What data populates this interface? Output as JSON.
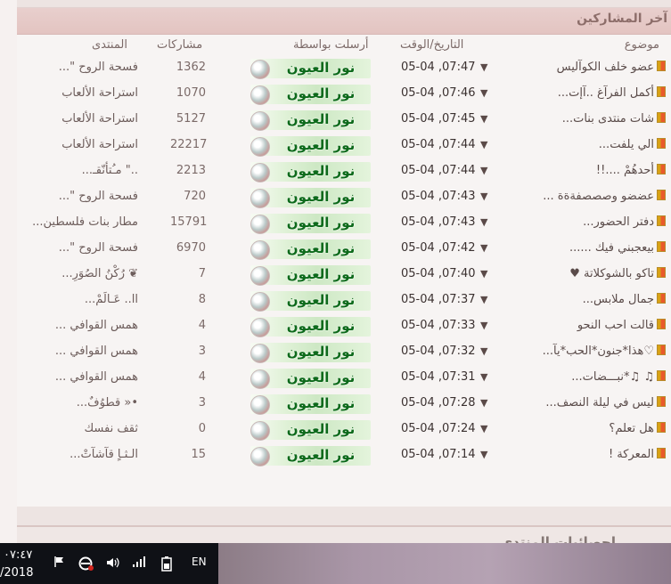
{
  "panel": {
    "title": "آخر المشاركين",
    "headers": {
      "topic": "موضوع",
      "date": "التاريخ/الوقت",
      "sender": "أرسلت بواسطة",
      "posts": "مشاركات",
      "forum": "المنتدى"
    },
    "rows": [
      {
        "topic": "عضو خلف الكوآليس",
        "date": "05-04 ,07:47",
        "sender": "نور العيون",
        "posts": "1362",
        "forum": "فسحة الروح \"..."
      },
      {
        "topic": "أكمل الفرآغ ..آإت...",
        "date": "05-04 ,07:46",
        "sender": "نور العيون",
        "posts": "1070",
        "forum": "استراحة الألعاب"
      },
      {
        "topic": "شات منتدى بنات...",
        "date": "05-04 ,07:45",
        "sender": "نور العيون",
        "posts": "5127",
        "forum": "استراحة الألعاب"
      },
      {
        "topic": "الي يلفت...",
        "date": "05-04 ,07:44",
        "sender": "نور العيون",
        "posts": "22217",
        "forum": "استراحة الألعاب"
      },
      {
        "topic": "أحدهُمْ ....!!",
        "date": "05-04 ,07:44",
        "sender": "نور العيون",
        "posts": "2213",
        "forum": "..\" مـُتأنّقـ..."
      },
      {
        "topic": "عضضو وصصصفةةة ...",
        "date": "05-04 ,07:43",
        "sender": "نور العيون",
        "posts": "720",
        "forum": "فسحة الروح \"..."
      },
      {
        "topic": "دفتر الحضور...",
        "date": "05-04 ,07:43",
        "sender": "نور العيون",
        "posts": "15791",
        "forum": "مطار بنات فلسطين..."
      },
      {
        "topic": "بيعجبني فيك ......",
        "date": "05-04 ,07:42",
        "sender": "نور العيون",
        "posts": "6970",
        "forum": "فسحة الروح \"..."
      },
      {
        "topic": "تاكو بالشوكلاتة ♥",
        "date": "05-04 ,07:40",
        "sender": "نور العيون",
        "posts": "7",
        "forum": "❦ رُكْنُ الصُوَرِ..."
      },
      {
        "topic": "جمال ملابس...",
        "date": "05-04 ,07:37",
        "sender": "نور العيون",
        "posts": "8",
        "forum": "اا.. عَـالَمْ..."
      },
      {
        "topic": "قالت احب النحو",
        "date": "05-04 ,07:33",
        "sender": "نور العيون",
        "posts": "4",
        "forum": "همس القوافي ..."
      },
      {
        "topic": "♡هذا*جنون*الحب*يآ...",
        "date": "05-04 ,07:32",
        "sender": "نور العيون",
        "posts": "3",
        "forum": "همس القوافي ..."
      },
      {
        "topic": "♫ ♫*نبـــضات...",
        "date": "05-04 ,07:31",
        "sender": "نور العيون",
        "posts": "4",
        "forum": "همس القوافي ..."
      },
      {
        "topic": "ليس في ليلة النصف...",
        "date": "05-04 ,07:28",
        "sender": "نور العيون",
        "posts": "3",
        "forum": "•« قطوُفٌ..."
      },
      {
        "topic": "هل تعلم؟",
        "date": "05-04 ,07:24",
        "sender": "نور العيون",
        "posts": "0",
        "forum": "ثقف نفسك"
      },
      {
        "topic": "المعركة !",
        "date": "05-04 ,07:14",
        "sender": "نور العيون",
        "posts": "15",
        "forum": "الـثـاٍ قآشآتْ..."
      }
    ]
  },
  "stats_panel": {
    "title": "احصائيات المنتدى"
  },
  "taskbar": {
    "time": "٠٧:٤٧",
    "date": "/2018",
    "language": "EN",
    "icons": [
      "flag-icon",
      "internet-explorer-icon",
      "speaker-icon",
      "network-signal-icon",
      "battery-icon"
    ]
  }
}
